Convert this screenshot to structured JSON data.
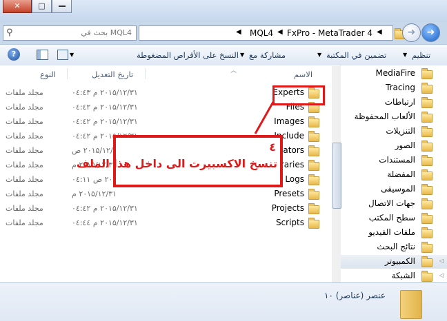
{
  "window": {
    "minimize_label": "▭",
    "maximize_label": "□",
    "close_label": "✕"
  },
  "address": {
    "path_segments": [
      "MQL4",
      "FxPro - MetaTrader 4"
    ],
    "search_placeholder": "بحث في MQL4"
  },
  "toolbar": {
    "organize": "تنظيم",
    "include_in_library": "تضمين في المكتبة",
    "share_with": "مشاركة مع",
    "burn": "النسخ على الأقراص المضغوطة"
  },
  "columns": {
    "name": "الاسم",
    "date_modified": "تاريخ التعديل",
    "type": "النوع"
  },
  "files": [
    {
      "name": "Experts",
      "date": "۲۰۱۵/۱۲/۳۱ م ۰٤:٤۳",
      "type": "مجلد ملفات"
    },
    {
      "name": "Files",
      "date": "۲۰۱۵/۱۲/۳۱ م ۰٤:٤۲",
      "type": "مجلد ملفات"
    },
    {
      "name": "Images",
      "date": "۲۰۱۵/۱۲/۳۱ م ۰٤:٤۲",
      "type": "مجلد ملفات"
    },
    {
      "name": "Include",
      "date": "۲۰۱۵/۱۲/۳۱ م ۰٤:٤۲",
      "type": "مجلد ملفات"
    },
    {
      "name": "Indicators",
      "date": "۲۰۱۵/۱۲/۲۲ ص",
      "type": "مجلد ملفات"
    },
    {
      "name": "Libraries",
      "date": "۲۰۱۵/۱۲/۳۱ م",
      "type": "مجلد ملفات"
    },
    {
      "name": "Logs",
      "date": "۲۰۱۵/۱۲/۲۲ ص ۰٤:۱۱",
      "type": "مجلد ملفات"
    },
    {
      "name": "Presets",
      "date": "۲۰۱۵/۱۲/۳۱ م",
      "type": "مجلد ملفات"
    },
    {
      "name": "Projects",
      "date": "۲۰۱۵/۱۲/۳۱ م ۰٤:٤۲",
      "type": "مجلد ملفات"
    },
    {
      "name": "Scripts",
      "date": "۲۰۱۵/۱۲/۳۱ م ۰٤:٤٤",
      "type": "مجلد ملفات"
    }
  ],
  "nav": [
    {
      "label": "MediaFire",
      "icon": "folder-icon"
    },
    {
      "label": "Tracing",
      "icon": "folder-icon"
    },
    {
      "label": "ارتباطات",
      "icon": "links-icon"
    },
    {
      "label": "الألعاب المحفوظة",
      "icon": "saved-games-icon"
    },
    {
      "label": "التنزيلات",
      "icon": "downloads-icon"
    },
    {
      "label": "الصور",
      "icon": "pictures-icon"
    },
    {
      "label": "المستندات",
      "icon": "documents-icon"
    },
    {
      "label": "المفضلة",
      "icon": "favorites-icon"
    },
    {
      "label": "الموسيقى",
      "icon": "music-icon"
    },
    {
      "label": "جهات الاتصال",
      "icon": "contacts-icon"
    },
    {
      "label": "سطح المكتب",
      "icon": "desktop-icon"
    },
    {
      "label": "ملفات الفيديو",
      "icon": "videos-icon"
    },
    {
      "label": "نتائج البحث",
      "icon": "searches-icon"
    },
    {
      "label": "الكمبيوتر",
      "icon": "computer-icon"
    },
    {
      "label": "الشبكة",
      "icon": "network-icon"
    }
  ],
  "status": {
    "item_count": "۱۰ عنصر (عناصر)"
  },
  "annotation": {
    "number": "٤",
    "text": "تنسخ الاكسبيرت الى داخل هذا الملف",
    "color": "#e01818"
  }
}
